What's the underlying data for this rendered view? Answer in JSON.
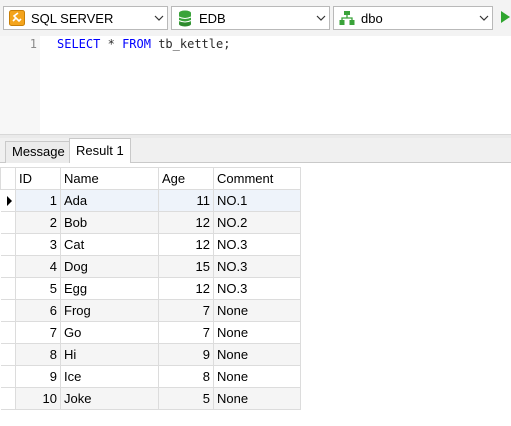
{
  "toolbar": {
    "connection": {
      "label": "SQL SERVER",
      "icon": "connection-icon",
      "color": "#f4a41c"
    },
    "database": {
      "label": "EDB",
      "icon": "database-icon",
      "color": "#3aa33a"
    },
    "schema": {
      "label": "dbo",
      "icon": "schema-icon",
      "color": "#3aa33a"
    },
    "run": {
      "icon": "run-icon",
      "color": "#2fa52f"
    }
  },
  "editor": {
    "line_number": "1",
    "tokens": {
      "select": "SELECT",
      "star": "*",
      "from": "FROM",
      "table": "tb_kettle;"
    }
  },
  "tabs": [
    {
      "label": "Message",
      "active": false
    },
    {
      "label": "Result 1",
      "active": true
    }
  ],
  "grid": {
    "columns": [
      "ID",
      "Name",
      "Age",
      "Comment"
    ],
    "rows": [
      [
        "1",
        "Ada",
        "11",
        "NO.1"
      ],
      [
        "2",
        "Bob",
        "12",
        "NO.2"
      ],
      [
        "3",
        "Cat",
        "12",
        "NO.3"
      ],
      [
        "4",
        "Dog",
        "15",
        "NO.3"
      ],
      [
        "5",
        "Egg",
        "12",
        "NO.3"
      ],
      [
        "6",
        "Frog",
        "7",
        "None"
      ],
      [
        "7",
        "Go",
        "7",
        "None"
      ],
      [
        "8",
        "Hi",
        "9",
        "None"
      ],
      [
        "9",
        "Ice",
        "8",
        "None"
      ],
      [
        "10",
        "Joke",
        "5",
        "None"
      ]
    ]
  }
}
